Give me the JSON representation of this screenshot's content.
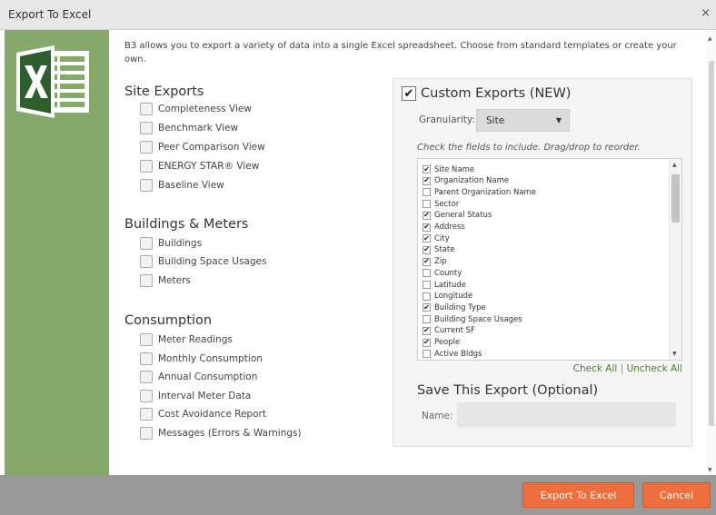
{
  "window": {
    "title": "Export To Excel",
    "close_glyph": "×"
  },
  "intro_text": "B3 allows you to export a variety of data into a single Excel spreadsheet. Choose from standard templates or create your own.",
  "sections": [
    {
      "title": "Site Exports",
      "items": [
        "Completeness View",
        "Benchmark View",
        "Peer Comparison View",
        "ENERGY STAR® View",
        "Baseline View"
      ]
    },
    {
      "title": "Buildings & Meters",
      "items": [
        "Buildings",
        "Building Space Usages",
        "Meters"
      ]
    },
    {
      "title": "Consumption",
      "items": [
        "Meter Readings",
        "Monthly Consumption",
        "Annual Consumption",
        "Interval Meter Data",
        "Cost Avoidance Report",
        "Messages (Errors & Warnings)"
      ]
    }
  ],
  "custom": {
    "title": "Custom Exports (NEW)",
    "checked": true,
    "granularity_label": "Granularity:",
    "granularity_value": "Site",
    "hint": "Check the fields to include. Drag/drop to reorder.",
    "fields": [
      {
        "label": "Site Name",
        "checked": true
      },
      {
        "label": "Organization Name",
        "checked": true
      },
      {
        "label": "Parent Organization Name",
        "checked": false
      },
      {
        "label": "Sector",
        "checked": false
      },
      {
        "label": "General Status",
        "checked": true
      },
      {
        "label": "Address",
        "checked": true
      },
      {
        "label": "City",
        "checked": true
      },
      {
        "label": "State",
        "checked": true
      },
      {
        "label": "Zip",
        "checked": true
      },
      {
        "label": "County",
        "checked": false
      },
      {
        "label": "Latitude",
        "checked": false
      },
      {
        "label": "Longitude",
        "checked": false
      },
      {
        "label": "Building Type",
        "checked": true
      },
      {
        "label": "Building Space Usages",
        "checked": false
      },
      {
        "label": "Current SF",
        "checked": true
      },
      {
        "label": "People",
        "checked": true
      },
      {
        "label": "Active Bldgs",
        "checked": false
      }
    ],
    "check_all": "Check All",
    "separator": "|",
    "uncheck_all": "Uncheck All",
    "save_title": "Save This Export (Optional)",
    "name_label": "Name:",
    "name_value": ""
  },
  "footer": {
    "export_label": "Export To Excel",
    "cancel_label": "Cancel"
  },
  "colors": {
    "accent_green": "#84a96b",
    "button_orange": "#ef6e3d",
    "footer_gray": "#999999"
  }
}
